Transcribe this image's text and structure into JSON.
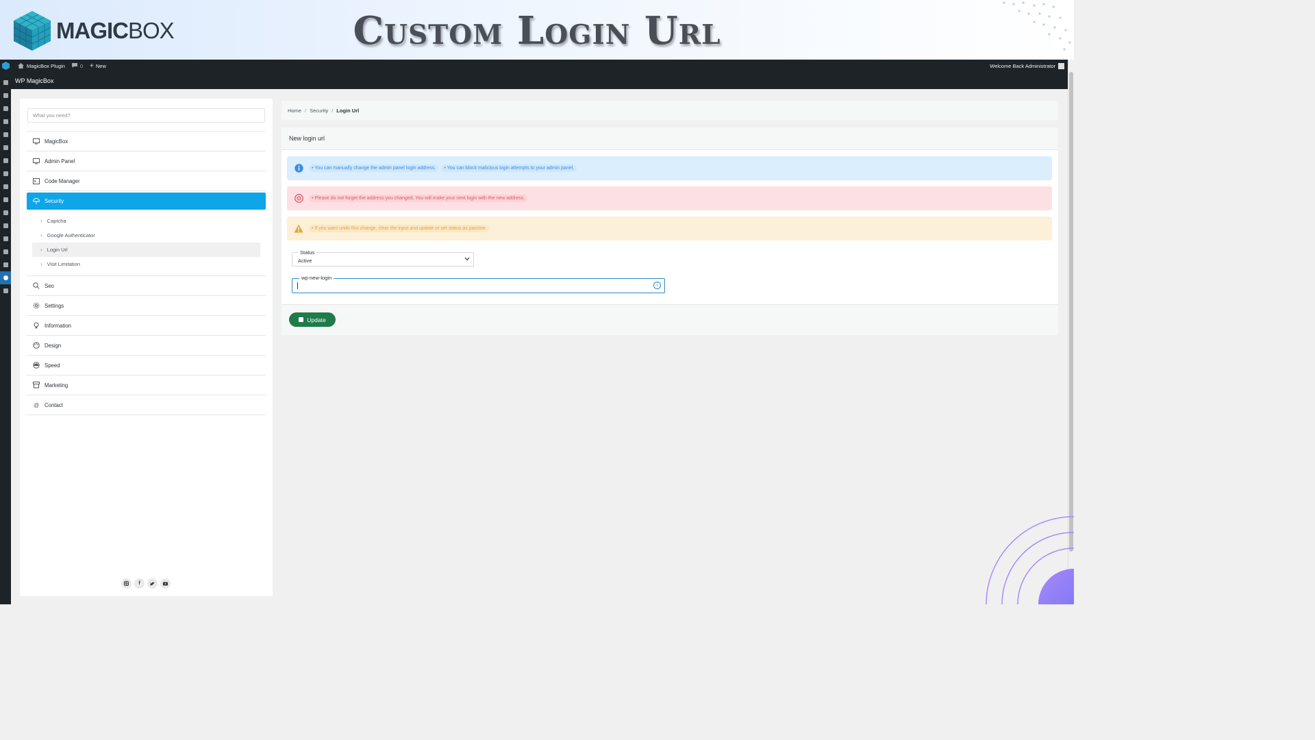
{
  "banner": {
    "logo_bold": "MAGIC",
    "logo_light": "BOX",
    "heading": "Custom Login Url"
  },
  "adminbar": {
    "site_name": "MagicBox Plugin",
    "comments_count": "0",
    "new_label": "New",
    "welcome": "Welcome Back Administrator"
  },
  "subbar": {
    "title": "WP MagicBox"
  },
  "search": {
    "placeholder": "What you need?"
  },
  "nav": {
    "magicbox": "MagicBox",
    "admin_panel": "Admin Panel",
    "code_manager": "Code Manager",
    "security": "Security",
    "security_sub": [
      "Captcha",
      "Google Authenticator",
      "Login Url",
      "Visit Limitation"
    ],
    "seo": "Seo",
    "settings": "Settings",
    "information": "Information",
    "design": "Design",
    "speed": "Speed",
    "marketing": "Marketing",
    "contact": "Contact"
  },
  "breadcrumb": {
    "home": "Home",
    "section": "Security",
    "current": "Login Url"
  },
  "card": {
    "title": "New login url",
    "info_1": "You can manually change the admin panel login address.",
    "info_2": "You can block malicious login attempts to your admin panel.",
    "danger": "Please do not forget the address you changed. You will make your next login with the new address.",
    "warn": "If you want undo this change, clear the input and update or set status as passive.",
    "status_label": "Status",
    "status_value": "Active",
    "login_label": "wp-new-login",
    "update_label": "Update"
  },
  "colors": {
    "accent": "#0ea5e9",
    "update": "#1e7b4a",
    "adminbar": "#1d2327"
  }
}
